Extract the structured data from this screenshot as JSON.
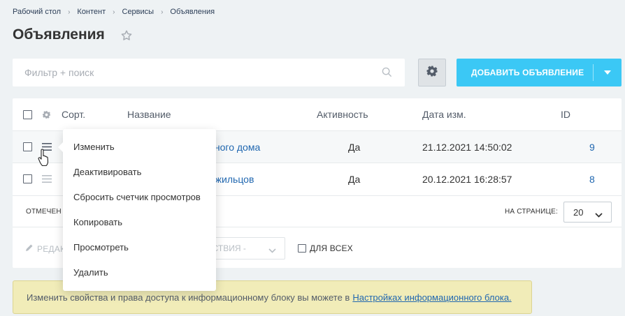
{
  "breadcrumb": [
    "Рабочий стол",
    "Контент",
    "Сервисы",
    "Объявления"
  ],
  "page_title": "Объявления",
  "search": {
    "placeholder": "Фильтр + поиск"
  },
  "add_button": {
    "label": "ДОБАВИТЬ ОБЪЯВЛЕНИЕ"
  },
  "grid": {
    "headers": {
      "sort": "Сорт.",
      "name": "Название",
      "activity": "Активность",
      "date": "Дата изм.",
      "id": "ID"
    },
    "rows": [
      {
        "name": "ндного дома",
        "activity": "Да",
        "date": "21.12.2021 14:50:02",
        "id": "9"
      },
      {
        "name": "е жильцов",
        "activity": "Да",
        "date": "20.12.2021 16:28:57",
        "id": "8"
      }
    ],
    "footer": {
      "marked_label": "ОТМЕЧЕН",
      "per_page_label": "НА СТРАНИЦЕ:",
      "per_page_value": "20"
    },
    "actions": {
      "edit_label": "РЕДАК",
      "actions_label": "ЙСТВИЯ -",
      "for_all_label": "ДЛЯ ВСЕХ"
    }
  },
  "context_menu": [
    "Изменить",
    "Деактивировать",
    "Сбросить счетчик просмотров",
    "Копировать",
    "Просмотреть",
    "Удалить"
  ],
  "info_bar": {
    "text": "Изменить свойства и права доступа к информационному блоку вы можете в",
    "link": "Настройках информационного блока."
  },
  "colors": {
    "accent": "#3bc8f5",
    "link": "#2067b0",
    "background": "#eef2f4",
    "info_bg": "#f1ecb8"
  }
}
